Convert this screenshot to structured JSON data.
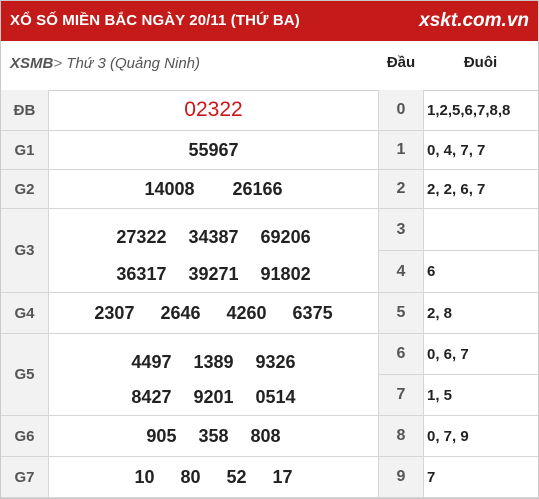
{
  "header": {
    "title": "XỔ SỐ MIỀN BẮC NGÀY 20/11 (THỨ BA)",
    "logo": "xskt.com.vn"
  },
  "subheader": {
    "crumb_prefix": "XSMB",
    "crumb_arrow": ">",
    "crumb_day": " Thứ 3 ",
    "crumb_province": "(Quảng Ninh)",
    "col_dau": "Đầu",
    "col_duoi": "Đuôi"
  },
  "prizes": [
    {
      "label": "ĐB",
      "lines": [
        [
          "02322"
        ]
      ]
    },
    {
      "label": "G1",
      "lines": [
        [
          "55967"
        ]
      ]
    },
    {
      "label": "G2",
      "lines": [
        [
          "14008",
          "26166"
        ]
      ]
    },
    {
      "label": "G3",
      "lines": [
        [
          "27322",
          "34387",
          "69206"
        ],
        [
          "36317",
          "39271",
          "91802"
        ]
      ]
    },
    {
      "label": "G4",
      "lines": [
        [
          "2307",
          "2646",
          "4260",
          "6375"
        ]
      ]
    },
    {
      "label": "G5",
      "lines": [
        [
          "4497",
          "1389",
          "9326"
        ],
        [
          "8427",
          "9201",
          "0514"
        ]
      ]
    },
    {
      "label": "G6",
      "lines": [
        [
          "905",
          "358",
          "808"
        ]
      ]
    },
    {
      "label": "G7",
      "lines": [
        [
          "10",
          "80",
          "52",
          "17"
        ]
      ]
    }
  ],
  "loto": [
    {
      "dau": "0",
      "duoi": "1,2,5,6,7,8,8"
    },
    {
      "dau": "1",
      "duoi": "0, 4, 7, 7"
    },
    {
      "dau": "2",
      "duoi": "2, 2, 6, 7"
    },
    {
      "dau": "3",
      "duoi": ""
    },
    {
      "dau": "4",
      "duoi": "6"
    },
    {
      "dau": "5",
      "duoi": "2, 8"
    },
    {
      "dau": "6",
      "duoi": "0, 6, 7"
    },
    {
      "dau": "7",
      "duoi": "1, 5"
    },
    {
      "dau": "8",
      "duoi": "0, 7, 9"
    },
    {
      "dau": "9",
      "duoi": "7"
    }
  ],
  "colors": {
    "header_bg": "#c41a1a",
    "special_prize": "#d0151a",
    "label_bg": "#f2f2f2"
  }
}
